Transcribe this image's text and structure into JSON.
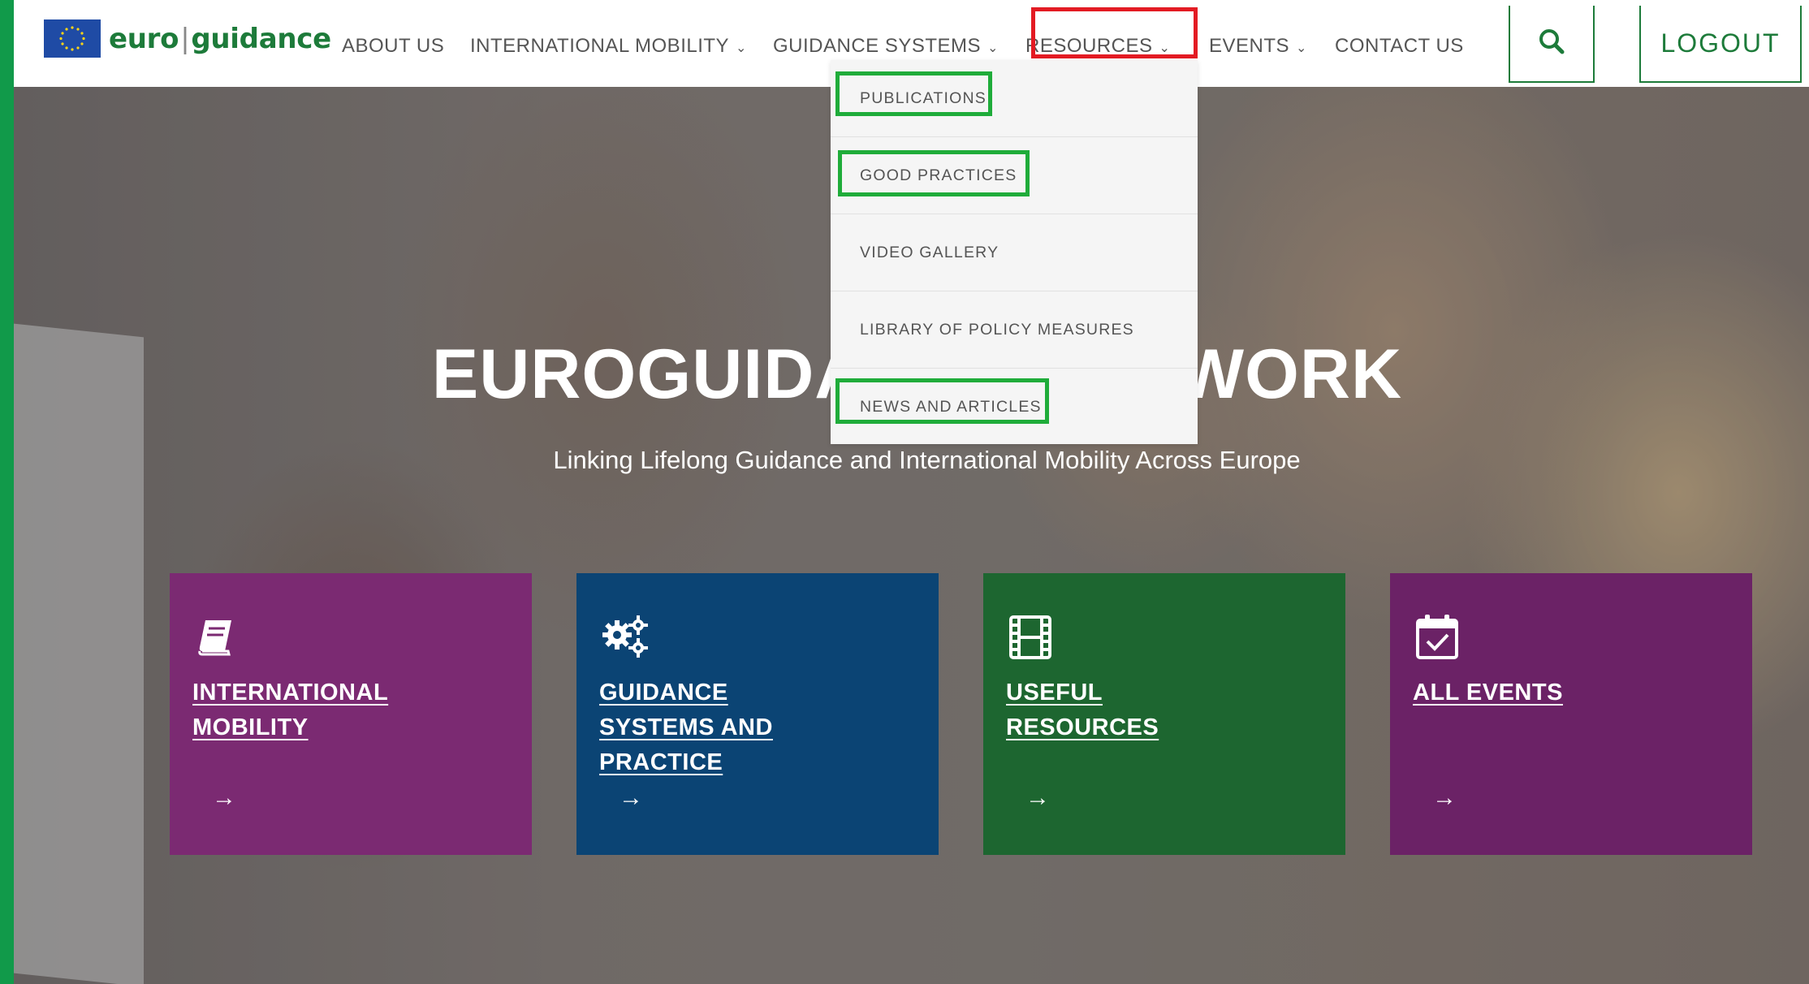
{
  "logo": {
    "text_left": "euro",
    "text_sep": "|",
    "text_right": "guidance"
  },
  "nav": {
    "items": [
      {
        "label": "ABOUT US",
        "has_dropdown": false
      },
      {
        "label": "INTERNATIONAL MOBILITY",
        "has_dropdown": true
      },
      {
        "label": "GUIDANCE SYSTEMS",
        "has_dropdown": true
      },
      {
        "label": "RESOURCES",
        "has_dropdown": true,
        "highlighted": true
      },
      {
        "label": "EVENTS",
        "has_dropdown": true
      },
      {
        "label": "CONTACT US",
        "has_dropdown": false
      }
    ],
    "chevron": "⌄",
    "search_icon": "search-icon",
    "logout_label": "LOGOUT"
  },
  "resources_menu": {
    "items": [
      {
        "label": "PUBLICATIONS",
        "highlighted": true
      },
      {
        "label": "GOOD PRACTICES",
        "highlighted": true
      },
      {
        "label": "VIDEO GALLERY",
        "highlighted": false
      },
      {
        "label": "LIBRARY OF POLICY MEASURES",
        "highlighted": false
      },
      {
        "label": "NEWS AND ARTICLES",
        "highlighted": true
      }
    ]
  },
  "hero": {
    "title": "EUROGUIDANCE NETWORK",
    "subtitle": "Linking Lifelong Guidance and International Mobility Across Europe"
  },
  "tiles": [
    {
      "label": "INTERNATIONAL MOBILITY",
      "icon": "book-icon",
      "color": "#7b2a72"
    },
    {
      "label": "GUIDANCE SYSTEMS AND PRACTICE",
      "icon": "gears-icon",
      "color": "#0b4474"
    },
    {
      "label": "USEFUL RESOURCES",
      "icon": "film-icon",
      "color": "#1d6630"
    },
    {
      "label": "ALL EVENTS",
      "icon": "calendar-check-icon",
      "color": "#6b2266"
    }
  ],
  "tile_arrow": "→",
  "colors": {
    "brand_green": "#1d7b3a",
    "highlight_red": "#e31b23",
    "highlight_green": "#1fac3a"
  }
}
